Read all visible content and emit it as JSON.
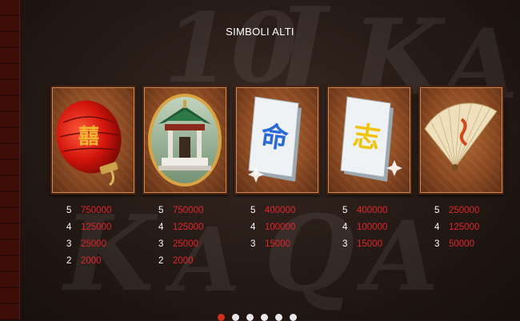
{
  "title": "SIMBOLI ALTI",
  "colors": {
    "payout": "#e0262b",
    "count": "#ffffff",
    "tile_bg": "#8c4a22"
  },
  "symbols": [
    {
      "name": "red-lantern",
      "icon": "lantern-icon",
      "pays": [
        {
          "count": "5",
          "value": "750000"
        },
        {
          "count": "4",
          "value": "125000"
        },
        {
          "count": "3",
          "value": "25000"
        },
        {
          "count": "2",
          "value": "2000"
        }
      ]
    },
    {
      "name": "pagoda",
      "icon": "pagoda-icon",
      "pays": [
        {
          "count": "5",
          "value": "750000"
        },
        {
          "count": "4",
          "value": "125000"
        },
        {
          "count": "3",
          "value": "25000"
        },
        {
          "count": "2",
          "value": "2000"
        }
      ]
    },
    {
      "name": "blue-mahjong-tile",
      "icon": "mahjong-tile-blue-icon",
      "pays": [
        {
          "count": "5",
          "value": "400000"
        },
        {
          "count": "4",
          "value": "100000"
        },
        {
          "count": "3",
          "value": "15000"
        }
      ]
    },
    {
      "name": "yellow-mahjong-tile",
      "icon": "mahjong-tile-yellow-icon",
      "pays": [
        {
          "count": "5",
          "value": "400000"
        },
        {
          "count": "4",
          "value": "100000"
        },
        {
          "count": "3",
          "value": "15000"
        }
      ]
    },
    {
      "name": "paper-fan",
      "icon": "fan-icon",
      "pays": [
        {
          "count": "5",
          "value": "250000"
        },
        {
          "count": "4",
          "value": "125000"
        },
        {
          "count": "3",
          "value": "50000"
        }
      ]
    }
  ],
  "pagination": {
    "pages": 6,
    "active": 0
  }
}
